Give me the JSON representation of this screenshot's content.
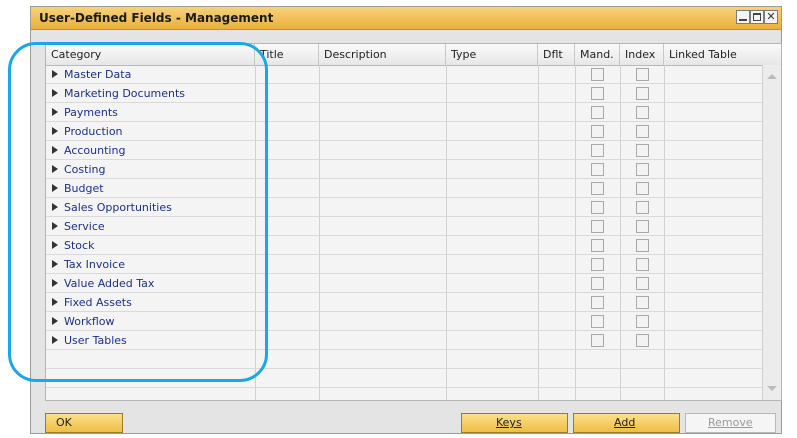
{
  "window": {
    "title": "User-Defined Fields - Management"
  },
  "grid": {
    "columns": {
      "category": "Category",
      "title": "Title",
      "description": "Description",
      "type": "Type",
      "dflt": "Dflt",
      "mand": "Mand.",
      "index": "Index",
      "linked_table": "Linked Table"
    },
    "rows": [
      {
        "label": "Master Data"
      },
      {
        "label": "Marketing Documents"
      },
      {
        "label": "Payments"
      },
      {
        "label": "Production"
      },
      {
        "label": "Accounting"
      },
      {
        "label": "Costing"
      },
      {
        "label": "Budget"
      },
      {
        "label": "Sales Opportunities"
      },
      {
        "label": "Service"
      },
      {
        "label": "Stock"
      },
      {
        "label": "Tax Invoice"
      },
      {
        "label": "Value Added Tax"
      },
      {
        "label": "Fixed Assets"
      },
      {
        "label": "Workflow"
      },
      {
        "label": "User Tables"
      }
    ]
  },
  "buttons": {
    "ok": "OK",
    "keys": "Keys",
    "add": "Add",
    "remove": "Remove"
  },
  "colors": {
    "annotation_highlight": "#1aa7ea",
    "title_bar": "#eab03a",
    "row_link_text": "#1c2f8c"
  }
}
